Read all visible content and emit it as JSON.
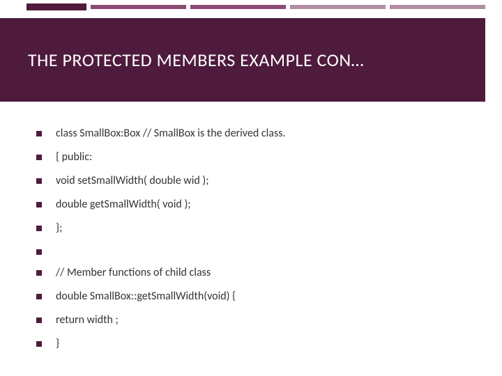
{
  "title": "THE PROTECTED MEMBERS EXAMPLE CON…",
  "bullets": [
    "class SmallBox:Box // SmallBox is the derived class.",
    "{    public:",
    "        void setSmallWidth( double wid );",
    "        double getSmallWidth( void );",
    "};",
    " ",
    "// Member functions of child class",
    "double SmallBox::getSmallWidth(void) {",
    "     return width ;",
    "}"
  ]
}
